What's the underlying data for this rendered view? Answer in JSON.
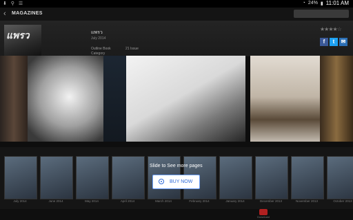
{
  "statusbar": {
    "time": "11:01 AM",
    "battery": "24%",
    "icons": [
      "download-icon",
      "usb-icon",
      "wifi-icon",
      "battery-icon"
    ]
  },
  "appbar": {
    "back_icon": "chevron-left-icon",
    "title": "MAGAZINES"
  },
  "detail": {
    "logo_text": "แพรว",
    "name": "แพรว",
    "date": "July 2014",
    "meta_left_1": "Outline Book",
    "meta_left_2": "Category",
    "meta_right": "21 Issue",
    "stars": "★★★★☆",
    "share": [
      "f",
      "t",
      "✉"
    ]
  },
  "spread": {
    "pages": [
      "far-left",
      "left",
      "mid-left",
      "mid-right",
      "right",
      "far-right"
    ]
  },
  "strip": {
    "issues": [
      {
        "label": "July 2014"
      },
      {
        "label": "June 2014"
      },
      {
        "label": "May 2014"
      },
      {
        "label": "April 2014"
      },
      {
        "label": "March 2014"
      },
      {
        "label": "February 2014"
      },
      {
        "label": "January 2014"
      },
      {
        "label": "December 2013"
      },
      {
        "label": "November 2013"
      },
      {
        "label": "October 2013"
      }
    ]
  },
  "overlay": {
    "slide_text": "Slide to See more pages",
    "buy_label": "BUY NOW",
    "buy_icon": "circle-dot-icon"
  },
  "bottombar": {
    "download_label": "Download",
    "download_icon": "download-icon"
  },
  "colors": {
    "accent": "#2f6bd9",
    "facebook": "#3b5998",
    "twitter": "#1da1f2",
    "download": "#b02020"
  }
}
